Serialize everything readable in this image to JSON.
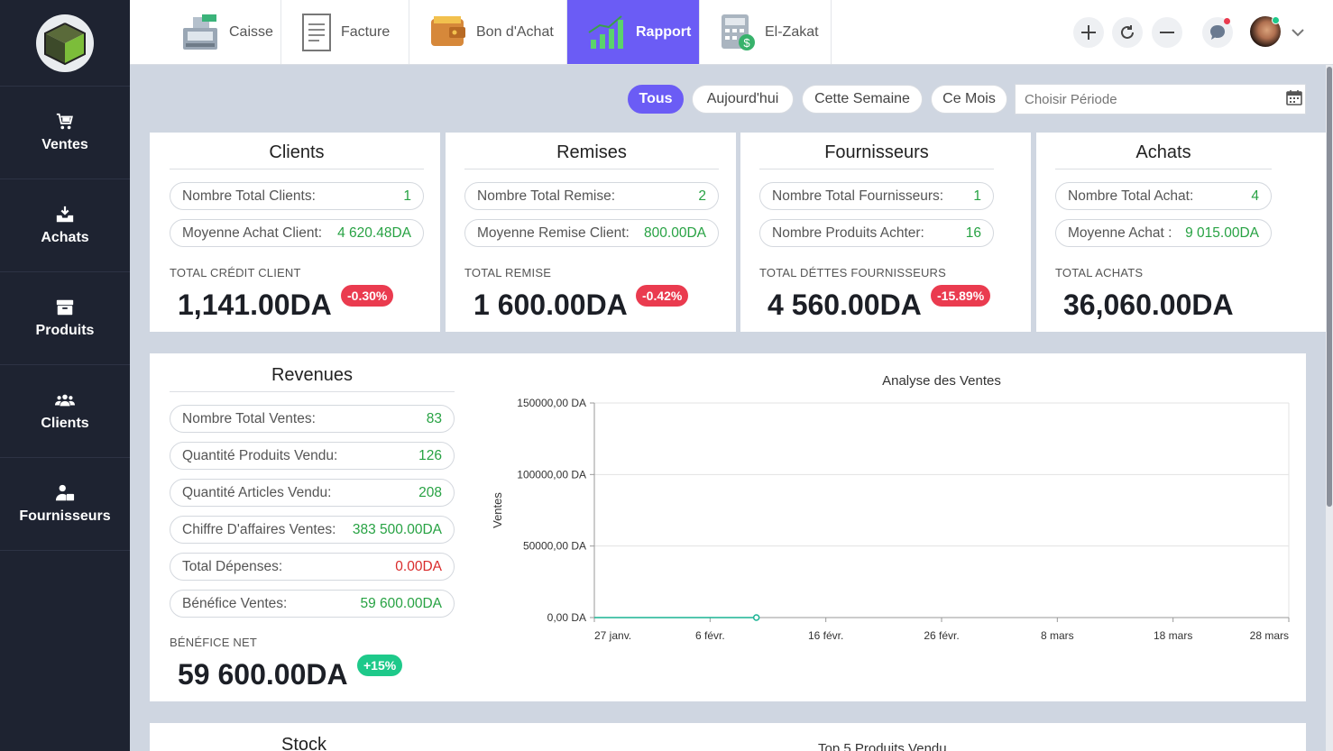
{
  "sidebar": {
    "logo_icon": "cube-logo",
    "items": [
      {
        "label": "Ventes",
        "icon": "cart-icon"
      },
      {
        "label": "Achats",
        "icon": "inbox-download-icon"
      },
      {
        "label": "Produits",
        "icon": "box-icon"
      },
      {
        "label": "Clients",
        "icon": "users-icon"
      },
      {
        "label": "Fournisseurs",
        "icon": "supplier-icon"
      }
    ]
  },
  "topbar": {
    "tabs": [
      {
        "label": "Caisse",
        "icon": "cash-register-icon"
      },
      {
        "label": "Facture",
        "icon": "invoice-icon"
      },
      {
        "label": "Bon d'Achat",
        "icon": "wallet-icon"
      },
      {
        "label": "Rapport",
        "icon": "bar-chart-icon",
        "active": true
      },
      {
        "label": "El-Zakat",
        "icon": "calculator-icon"
      }
    ],
    "actions": [
      "plus-icon",
      "refresh-icon",
      "minus-icon",
      "chat-icon"
    ]
  },
  "filters": {
    "buttons": [
      "Tous",
      "Aujourd'hui",
      "Cette Semaine",
      "Ce Mois"
    ],
    "period_placeholder": "Choisir Période"
  },
  "cards": {
    "clients": {
      "title": "Clients",
      "stats": [
        {
          "label": "Nombre Total Clients:",
          "value": "1"
        },
        {
          "label": "Moyenne Achat Client:",
          "value": "4 620.48DA"
        }
      ],
      "total_label": "TOTAL CRÉDIT CLIENT",
      "total_value": "1,141.00DA",
      "badge": "-0.30%"
    },
    "remises": {
      "title": "Remises",
      "stats": [
        {
          "label": "Nombre Total Remise:",
          "value": "2"
        },
        {
          "label": "Moyenne Remise Client:",
          "value": "800.00DA"
        }
      ],
      "total_label": "TOTAL REMISE",
      "total_value": "1 600.00DA",
      "badge": "-0.42%"
    },
    "fournisseurs": {
      "title": "Fournisseurs",
      "stats": [
        {
          "label": "Nombre Total Fournisseurs:",
          "value": "1"
        },
        {
          "label": "Nombre Produits Achter:",
          "value": "16"
        }
      ],
      "total_label": "TOTAL DÉTTES FOURNISSEURS",
      "total_value": "4 560.00DA",
      "badge": "-15.89%"
    },
    "achats": {
      "title": "Achats",
      "stats": [
        {
          "label": "Nombre Total Achat:",
          "value": "4"
        },
        {
          "label": "Moyenne Achat :",
          "value": "9 015.00DA"
        }
      ],
      "total_label": "TOTAL ACHATS",
      "total_value": "36,060.00DA"
    }
  },
  "revenues": {
    "title": "Revenues",
    "stats": [
      {
        "label": "Nombre Total Ventes:",
        "value": "83"
      },
      {
        "label": "Quantité Produits Vendu:",
        "value": "126"
      },
      {
        "label": "Quantité Articles Vendu:",
        "value": "208"
      },
      {
        "label": "Chiffre D'affaires Ventes:",
        "value": "383 500.00DA"
      },
      {
        "label": "Total Dépenses:",
        "value": "0.00DA"
      },
      {
        "label": "Bénéfice Ventes:",
        "value": "59 600.00DA"
      }
    ],
    "net_label": "BÉNÉFICE NET",
    "net_value": "59 600.00DA",
    "net_badge": "+15%"
  },
  "chart_data": {
    "type": "line",
    "title": "Analyse des Ventes",
    "xlabel": "",
    "ylabel": "Ventes",
    "x_ticks": [
      "27 janv.",
      "6 févr.",
      "16 févr.",
      "26 févr.",
      "8 mars",
      "18 mars",
      "28 mars"
    ],
    "y_ticks": [
      "0,00 DA",
      "50000,00 DA",
      "100000,00 DA",
      "150000,00 DA"
    ],
    "ylim": [
      0,
      150000
    ],
    "grid": true,
    "series": [
      {
        "x": [
          "27 janv.",
          "10 févr."
        ],
        "values": [
          0,
          0
        ],
        "color": "#1ab394"
      }
    ]
  },
  "bottom": {
    "stock_title": "Stock",
    "top5_title": "Top 5 Produits Vendu"
  },
  "colors": {
    "accent": "#6b5cf5",
    "sidebar": "#1e2331",
    "positive": "#27a243",
    "negative": "#ea3b4f"
  }
}
